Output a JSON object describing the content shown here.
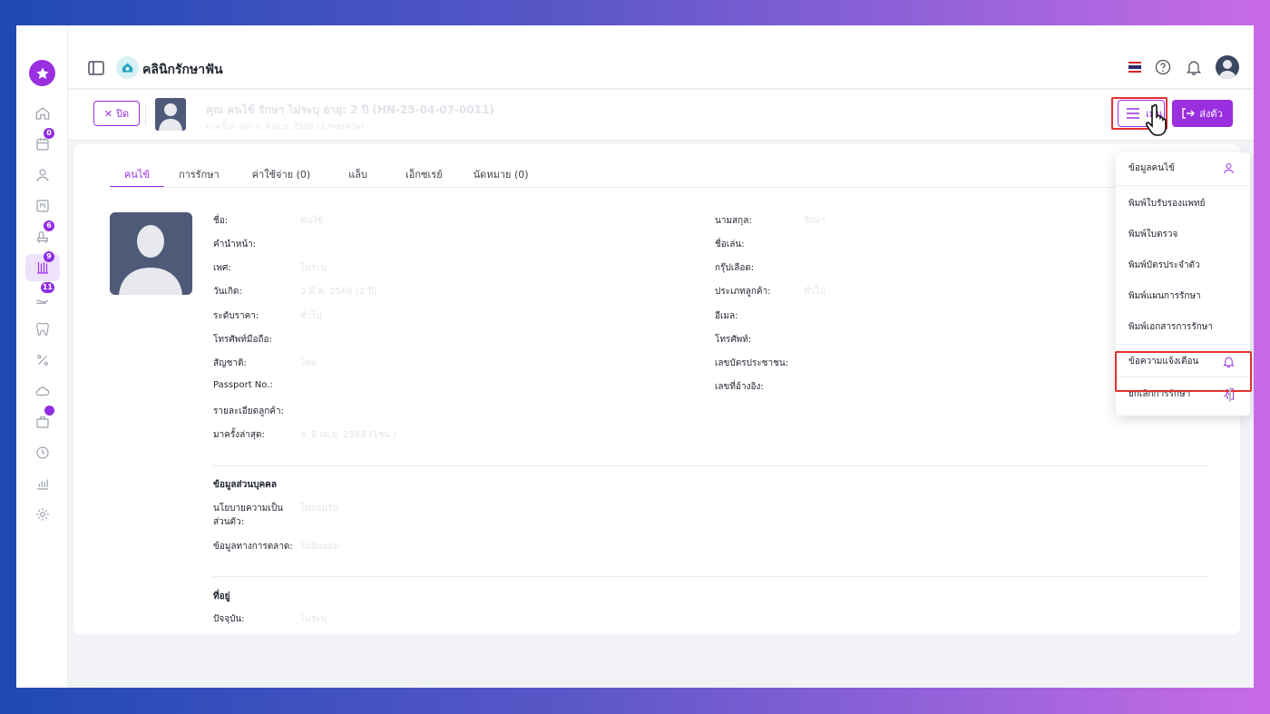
{
  "header": {
    "clinic_name": "คลินิกรักษาฟัน"
  },
  "rail_badges": {
    "calendar": "0",
    "waiting": "6",
    "treatment": "9",
    "payment": "11"
  },
  "patient": {
    "close_label": "ปิด",
    "name_line": "คุณ คนไข้ รักษา ไม่ระบุ อายุ: 2 ปี (HN-25-04-07-0011)",
    "sub_line": "มาครั้งล่าสุด: จ. 8 เม.ย. 2568 (1 ระยะผ่าน)",
    "menu_label": "เมนู",
    "send_label": "ส่งตัว"
  },
  "tabs": [
    "คนไข้",
    "การรักษา",
    "ค่าใช้จ่าย (0)",
    "แล็บ",
    "เอ็กซเรย์",
    "นัดหมาย (0)"
  ],
  "left_fields": [
    {
      "label": "ชื่อ:",
      "value": "คนไข้"
    },
    {
      "label": "คำนำหน้า:",
      "value": ""
    },
    {
      "label": "เพศ:",
      "value": "ไม่ระบุ"
    },
    {
      "label": "วันเกิด:",
      "value": "3 มี.ค. 2566 (2 ปี)"
    },
    {
      "label": "ระดับราคา:",
      "value": "ทั่วไป"
    },
    {
      "label": "โทรศัพท์มือถือ:",
      "value": ""
    },
    {
      "label": "สัญชาติ:",
      "value": "ไทย"
    },
    {
      "label": "Passport No.:",
      "value": ""
    },
    {
      "label": "รายละเอียดลูกค้า:",
      "value": ""
    },
    {
      "label": "มาครั้งล่าสุด:",
      "value": "จ. 8 เม.ย. 2568 (1ชม.)"
    }
  ],
  "right_fields": [
    {
      "label": "นามสกุล:",
      "value": "รักษา"
    },
    {
      "label": "ชื่อเล่น:",
      "value": ""
    },
    {
      "label": "กรุ๊ปเลือด:",
      "value": ""
    },
    {
      "label": "ประเภทลูกค้า:",
      "value": "ทั่วไป"
    },
    {
      "label": "อีเมล:",
      "value": ""
    },
    {
      "label": "โทรศัพท์:",
      "value": ""
    },
    {
      "label": "เลขบัตรประชาชน:",
      "value": ""
    },
    {
      "label": "เลขที่อ้างอิง:",
      "value": ""
    }
  ],
  "personal_section": {
    "title": "ข้อมูลส่วนบุคคล",
    "privacy_label_1": "นโยบายความเป็น",
    "privacy_label_2": "ส่วนตัว:",
    "privacy_value": "ไม่ยอมรับ",
    "marketing_label": "ข้อมูลทางการตลาด:",
    "marketing_value": "ไม่ยินยอม"
  },
  "address_section": {
    "title": "ที่อยู่",
    "current_label": "ปัจจุบัน:",
    "current_value": "ไม่ระบุ"
  },
  "dropdown": [
    "ข้อมูลคนไข้",
    "พิมพ์ใบรับรองแพทย์",
    "พิมพ์ใบตรวจ",
    "พิมพ์บัตรประจำตัว",
    "พิมพ์แผนการรักษา",
    "พิมพ์เอกสารการรักษา",
    "ข้อความแจ้งเตือน",
    "ยกเลิกการรักษา"
  ],
  "colors": {
    "accent": "#9a2fe0",
    "highlight": "#e23131"
  }
}
